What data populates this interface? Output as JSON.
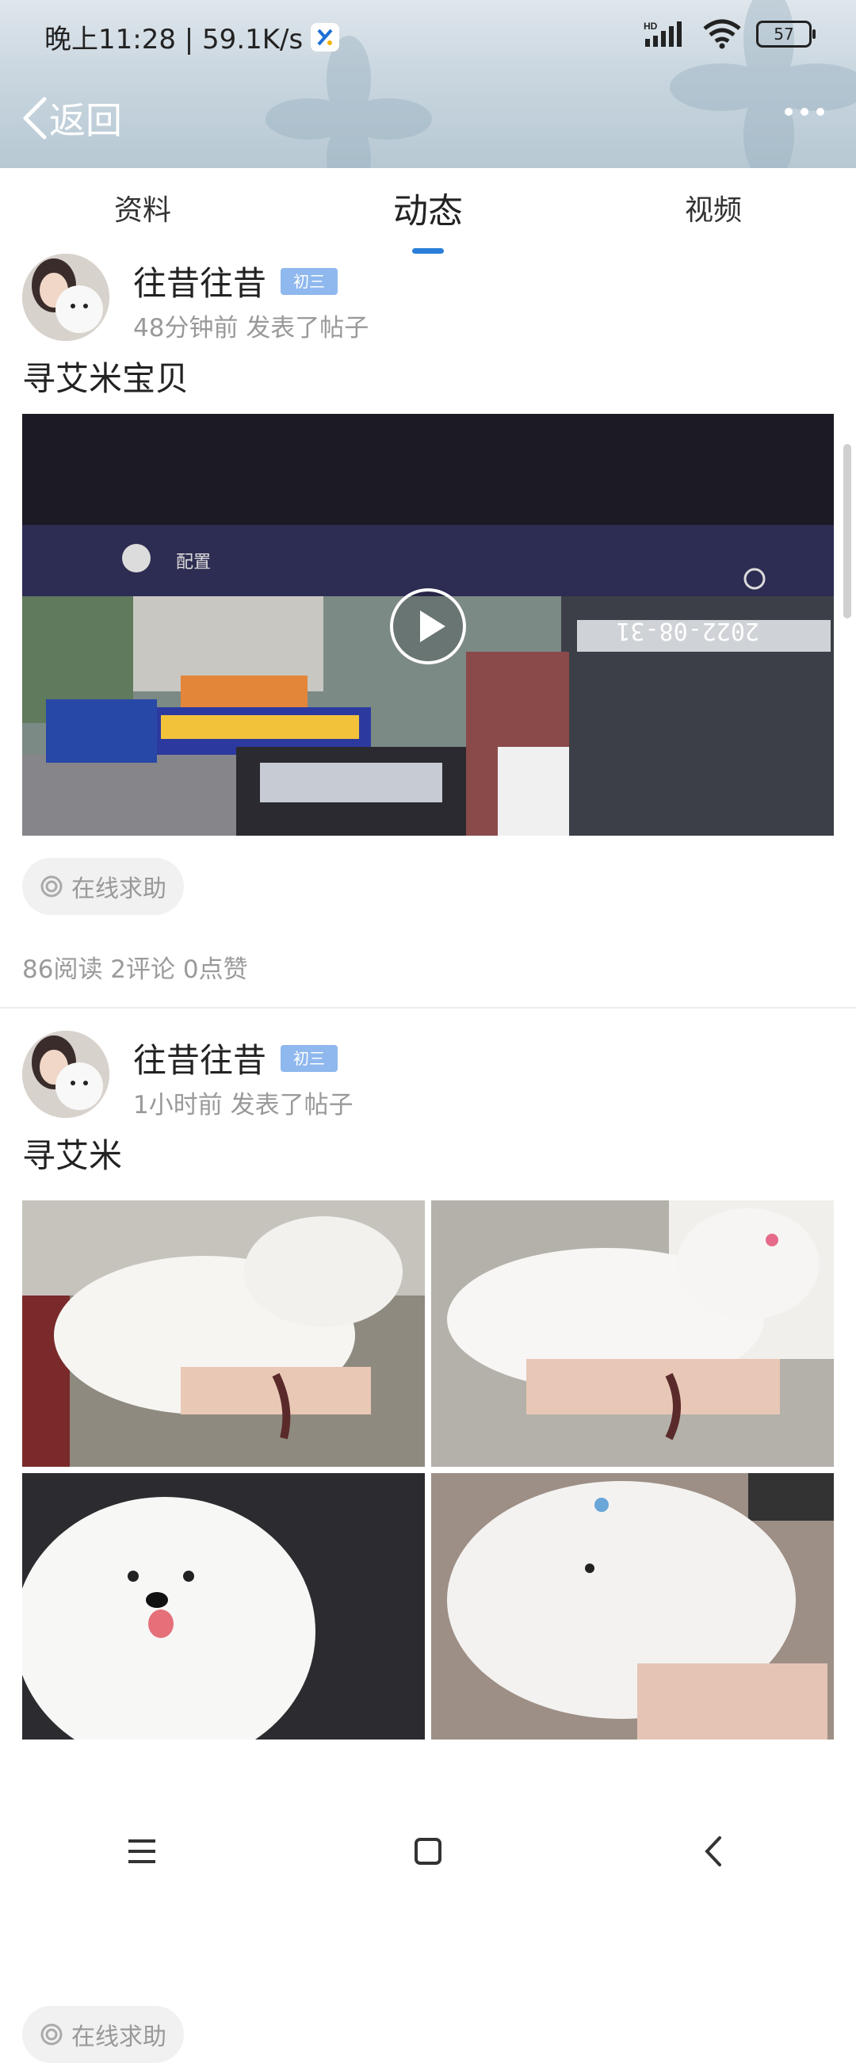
{
  "status_bar": {
    "time": "晚上11:28 | 59.1K/s",
    "battery": "57",
    "network": "HD"
  },
  "header": {
    "back_label": "返回"
  },
  "tabs": [
    {
      "label": "资料",
      "active": false
    },
    {
      "label": "动态",
      "active": true
    },
    {
      "label": "视频",
      "active": false
    }
  ],
  "posts": [
    {
      "user": "往昔往昔",
      "badge": "初三",
      "meta": "48分钟前  发表了帖子",
      "title": "寻艾米宝贝",
      "media_type": "video",
      "video_overlay": {
        "config_label": "配置",
        "date_text": "2022-08-31"
      },
      "help_label": "在线求助",
      "stats": "86阅读  2评论  0点赞"
    },
    {
      "user": "往昔往昔",
      "badge": "初三",
      "meta": "1小时前  发表了帖子",
      "title": "寻艾米",
      "media_type": "images",
      "help_label": "在线求助"
    }
  ],
  "icons": {
    "app_icon": "app-icon",
    "signal": "signal-icon",
    "wifi": "wifi-icon",
    "battery": "battery-icon",
    "back": "chevron-left-icon",
    "more": "more-icon",
    "play": "play-icon",
    "help": "target-icon",
    "menu": "menu-icon",
    "home": "home-icon",
    "back_nav": "back-icon"
  },
  "colors": {
    "accent": "#2b7fd9",
    "badge": "#8fb8ee",
    "meta_text": "#999999"
  }
}
